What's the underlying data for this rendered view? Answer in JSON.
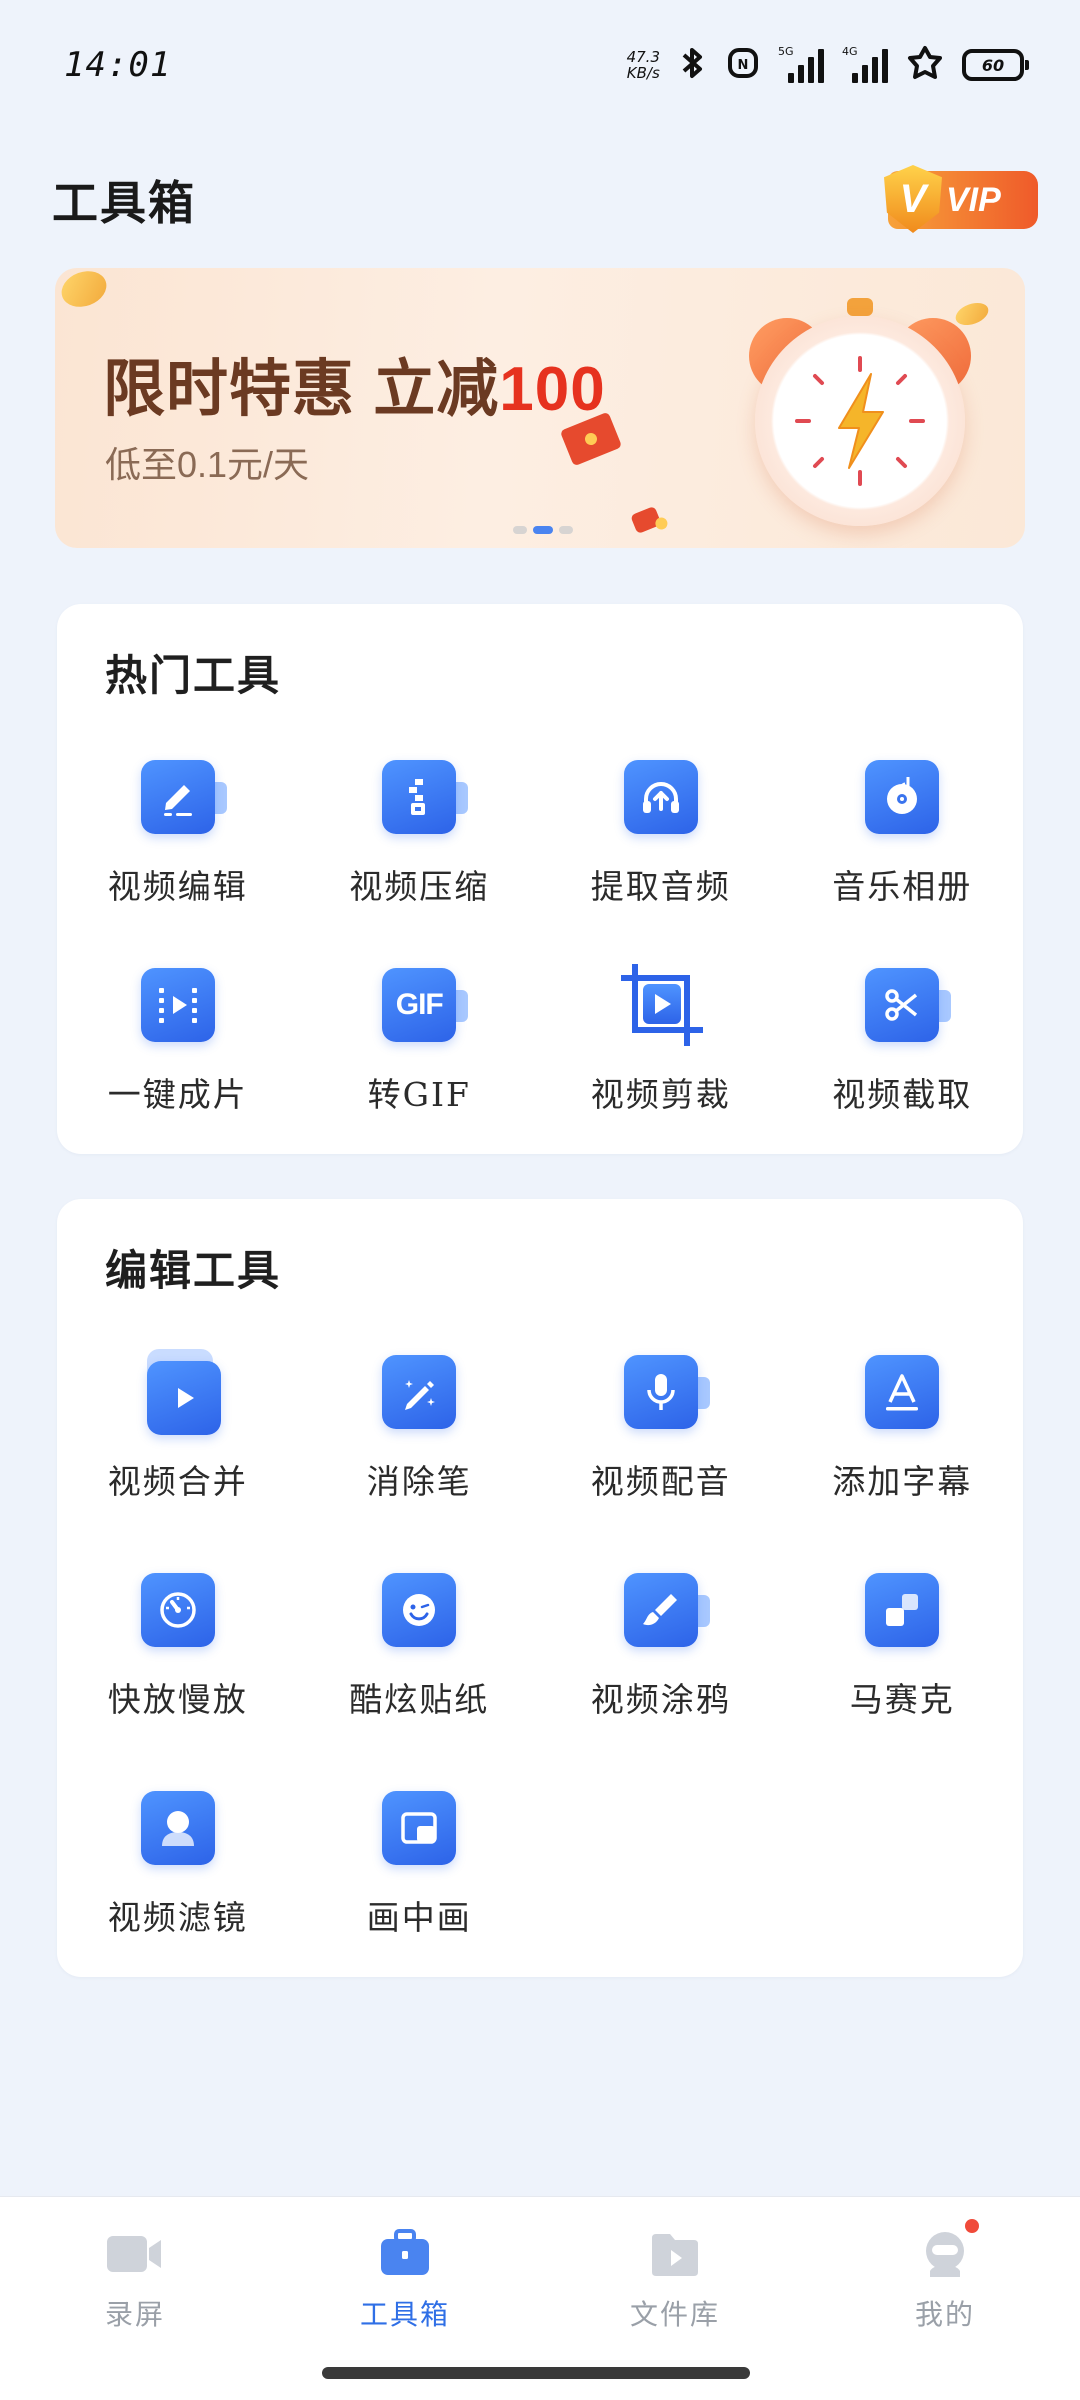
{
  "status_bar": {
    "time": "14:01",
    "net_speed_value": "47.3",
    "net_speed_unit": "KB/s",
    "sim1_tag": "5G",
    "sim2_tag": "4G",
    "battery": "60"
  },
  "header": {
    "title": "工具箱",
    "vip_label": "VIP",
    "vip_shield_letter": "V"
  },
  "banner": {
    "title_prefix": "限时特惠 立减",
    "title_highlight": "100",
    "subtitle": "低至0.1元/天",
    "active_index": 1,
    "dot_count": 3
  },
  "hot_tools": {
    "title": "热门工具",
    "items": [
      {
        "label": "视频编辑",
        "icon": "pencil-edit-icon"
      },
      {
        "label": "视频压缩",
        "icon": "zip-compress-icon"
      },
      {
        "label": "提取音频",
        "icon": "headphones-icon"
      },
      {
        "label": "音乐相册",
        "icon": "music-disc-icon"
      },
      {
        "label": "一键成片",
        "icon": "film-strip-icon"
      },
      {
        "label": "转GIF",
        "icon": "gif-icon",
        "icon_text": "GIF"
      },
      {
        "label": "视频剪裁",
        "icon": "crop-icon"
      },
      {
        "label": "视频截取",
        "icon": "scissors-icon"
      }
    ]
  },
  "edit_tools": {
    "title": "编辑工具",
    "items": [
      {
        "label": "视频合并",
        "icon": "merge-video-icon"
      },
      {
        "label": "消除笔",
        "icon": "magic-pen-icon"
      },
      {
        "label": "视频配音",
        "icon": "microphone-icon"
      },
      {
        "label": "添加字幕",
        "icon": "subtitle-a-icon"
      },
      {
        "label": "快放慢放",
        "icon": "speedometer-icon"
      },
      {
        "label": "酷炫贴纸",
        "icon": "smiley-sticker-icon"
      },
      {
        "label": "视频涂鸦",
        "icon": "doodle-brush-icon"
      },
      {
        "label": "马赛克",
        "icon": "mosaic-icon"
      },
      {
        "label": "视频滤镜",
        "icon": "filter-icon"
      },
      {
        "label": "画中画",
        "icon": "picture-in-picture-icon"
      }
    ]
  },
  "bottom_nav": {
    "items": [
      {
        "label": "录屏",
        "icon": "video-camera-icon",
        "active": false
      },
      {
        "label": "工具箱",
        "icon": "toolbox-icon",
        "active": true
      },
      {
        "label": "文件库",
        "icon": "folder-video-icon",
        "active": false
      },
      {
        "label": "我的",
        "icon": "profile-avatar-icon",
        "active": false,
        "badge": true
      }
    ]
  },
  "colors": {
    "accent": "#2f6fe6",
    "icon_gradient_start": "#4f94ff",
    "icon_gradient_end": "#2d63e8",
    "banner_highlight": "#e6321f",
    "background": "#eef3fb"
  }
}
